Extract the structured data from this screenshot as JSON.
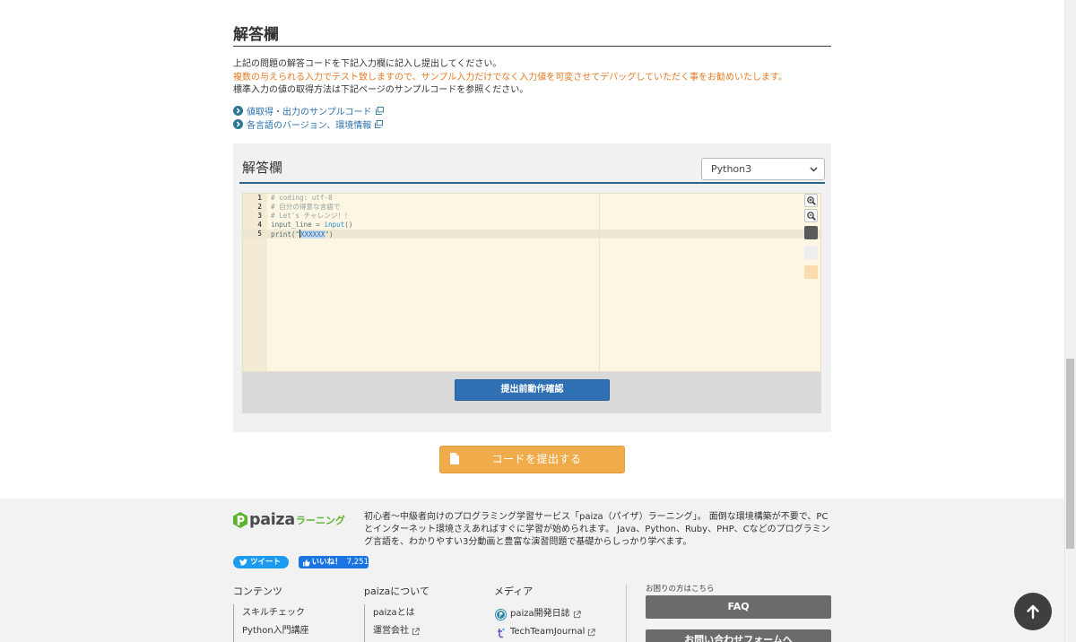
{
  "section": {
    "title": "解答欄"
  },
  "instructions": {
    "submit_note": "上記の問題の解答コードを下記入力欄に記入し提出してください。",
    "test_warning": "複数の与えられる入力でテスト致しますので、サンプル入力だけでなく入力値を可変させてデバッグしていただく事をお勧めいたします。",
    "stdin_note": "標準入力の値の取得方法は下記ページのサンプルコードを参照ください。"
  },
  "reference_links": [
    {
      "label": "値取得・出力のサンプルコード",
      "icon": "circle-arrow-right-icon",
      "trailing_icon": "external-window-icon"
    },
    {
      "label": "各言語のバージョン、環境情報",
      "icon": "circle-arrow-right-icon",
      "trailing_icon": "external-window-icon"
    }
  ],
  "editor_panel": {
    "title": "解答欄",
    "language_select": {
      "selected": "Python3",
      "icon": "chevron-down-icon"
    },
    "code_lines": [
      {
        "number": "1",
        "tokens": [
          "# coding: utf-8"
        ]
      },
      {
        "number": "2",
        "tokens": [
          "# 自分の得意な言語で"
        ]
      },
      {
        "number": "3",
        "tokens": [
          "# Let's チャレンジ！！"
        ]
      },
      {
        "number": "4",
        "tokens": [
          "input_line = ",
          "input",
          "()"
        ]
      },
      {
        "number": "5",
        "tokens": [
          "print(",
          "\"",
          "XXXXXX",
          "\"",
          ")"
        ]
      }
    ],
    "toolbar_icons": [
      "zoom-in-icon",
      "zoom-out-icon"
    ],
    "theme_swatch_colors": [
      "#5a5a5a",
      "#eeeeee",
      "#fcdcae"
    ],
    "check_button": "提出前動作確認"
  },
  "submit_button": {
    "label": "コードを提出する",
    "icon": "document-icon"
  },
  "footer": {
    "logo": {
      "wordmark": "paiza",
      "tagline": "ラーニング"
    },
    "description": "初心者〜中級者向けのプログラミング学習サービス「paiza（パイザ）ラーニング」。 面倒な環境構築が不要で、PCとインターネット環境さえあればすぐに学習が始められます。 Java、Python、Ruby、PHP、Cなどのプログラミング言語を、わかりやすい3分動画と豊富な演習問題で基礎からしっかり学べます。",
    "social": {
      "tweet_label": "ツイート",
      "like_label": "いいね！",
      "like_count": "7,251"
    },
    "columns": [
      {
        "heading": "コンテンツ",
        "items": [
          "スキルチェック",
          "Python入門講座"
        ]
      },
      {
        "heading": "paizaについて",
        "items": [
          "paizaとは",
          "運営会社"
        ]
      },
      {
        "heading": "メディア",
        "items": [
          "paiza開発日誌",
          "TechTeamJournal"
        ]
      }
    ],
    "help": {
      "caption": "お困りの方はこちら",
      "faq_button": "FAQ",
      "contact_button": "お問い合わせフォームへ"
    }
  },
  "scroll_top": {
    "icon": "arrow-up-icon"
  },
  "colors": {
    "link": "#2a6fab",
    "warning_text": "#e67a22",
    "panel_background": "#f1f1f1",
    "panel_header_rule": "#2c6788",
    "editor_background": "#fdf6e3",
    "action_bar_background": "#d9d9d9",
    "check_button": "#2f6fb3",
    "submit_button": "#f0ac4b",
    "brand_green": "#5cb531",
    "footer_background": "#f2f2f2",
    "footer_button": "#6b6b6b",
    "tweet_button": "#1d9bf0",
    "like_button": "#1b74e4",
    "scroll_top_button": "#3f3f3f"
  }
}
